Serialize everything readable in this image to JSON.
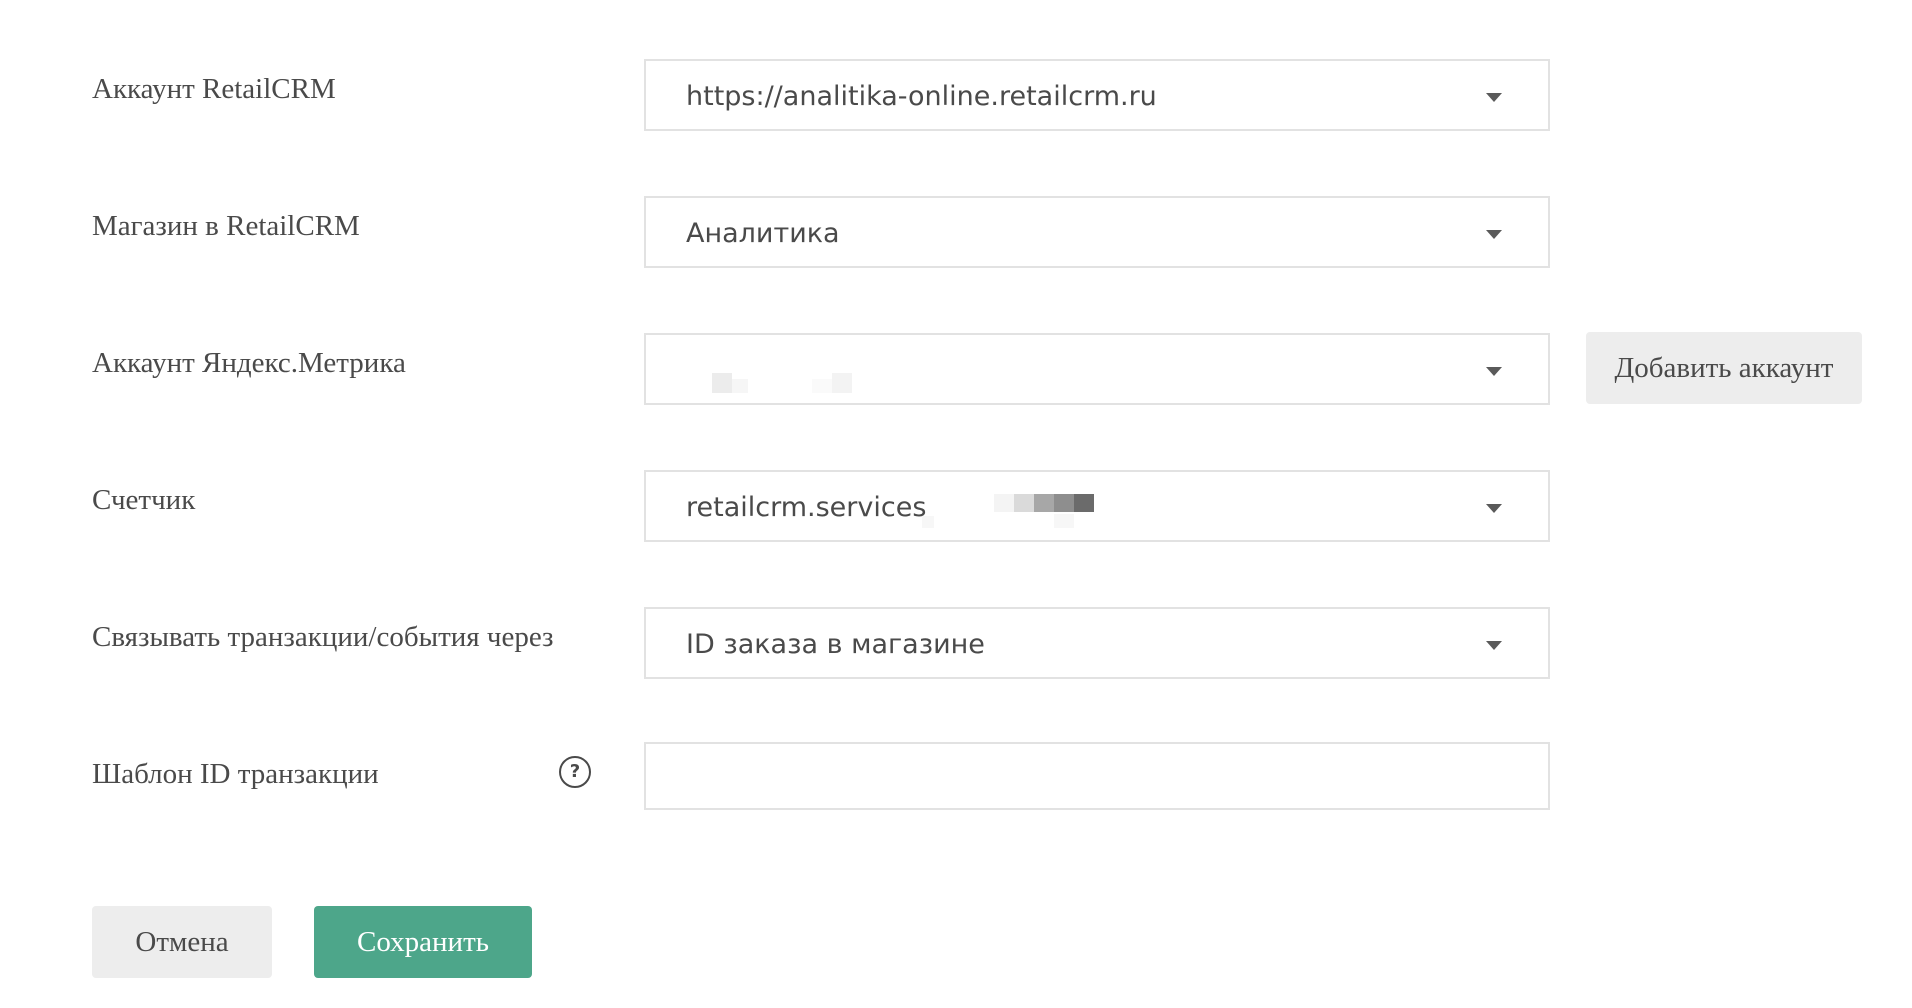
{
  "fields": {
    "retailcrm_account": {
      "label": "Аккаунт RetailCRM",
      "value": "https://analitika-online.retailcrm.ru"
    },
    "retailcrm_shop": {
      "label": "Магазин в RetailCRM",
      "value": "Аналитика"
    },
    "yandex_account": {
      "label": "Аккаунт Яндекс.Метрика",
      "value": "",
      "add_button_label": "Добавить аккаунт"
    },
    "counter": {
      "label": "Счетчик",
      "value": "retailcrm.services"
    },
    "link_via": {
      "label": "Связывать транзакции/события через",
      "value": "ID заказа в магазине"
    },
    "transaction_template": {
      "label": "Шаблон ID транзакции",
      "help_glyph": "?",
      "value": ""
    }
  },
  "actions": {
    "cancel_label": "Отмена",
    "save_label": "Сохранить"
  },
  "colors": {
    "primary": "#4da68a",
    "secondary_button": "#ededed",
    "text": "#4a4a4a",
    "border": "#e2e2e2"
  },
  "icons": {
    "dropdown": "chevron-down-icon",
    "help": "question-circle-icon"
  }
}
